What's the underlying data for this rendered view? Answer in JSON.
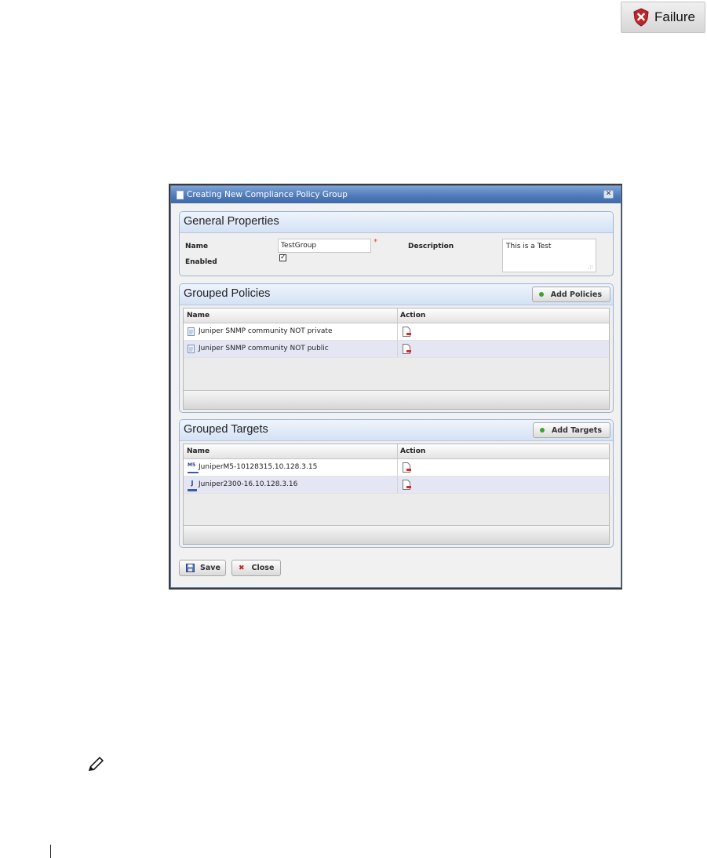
{
  "status_badge": {
    "label": "Failure"
  },
  "dialog": {
    "title": "Creating New Compliance Policy Group",
    "general": {
      "title": "General Properties",
      "name_label": "Name",
      "name_value": "TestGroup",
      "enabled_label": "Enabled",
      "enabled_mark": "✓",
      "description_label": "Description",
      "description_value": "This is a Test"
    },
    "policies": {
      "title": "Grouped Policies",
      "add_label": "Add Policies",
      "columns": [
        "Name",
        "Action"
      ],
      "rows": [
        {
          "name": "Juniper SNMP community NOT private"
        },
        {
          "name": "Juniper SNMP community NOT public"
        }
      ]
    },
    "targets": {
      "title": "Grouped Targets",
      "add_label": "Add Targets",
      "columns": [
        "Name",
        "Action"
      ],
      "rows": [
        {
          "name": "JuniperM5-10128315.10.128.3.15",
          "icon_text": "M5"
        },
        {
          "name": "Juniper2300-16.10.128.3.16",
          "icon_text": "J"
        }
      ]
    },
    "save_label": "Save",
    "close_label": "Close"
  }
}
